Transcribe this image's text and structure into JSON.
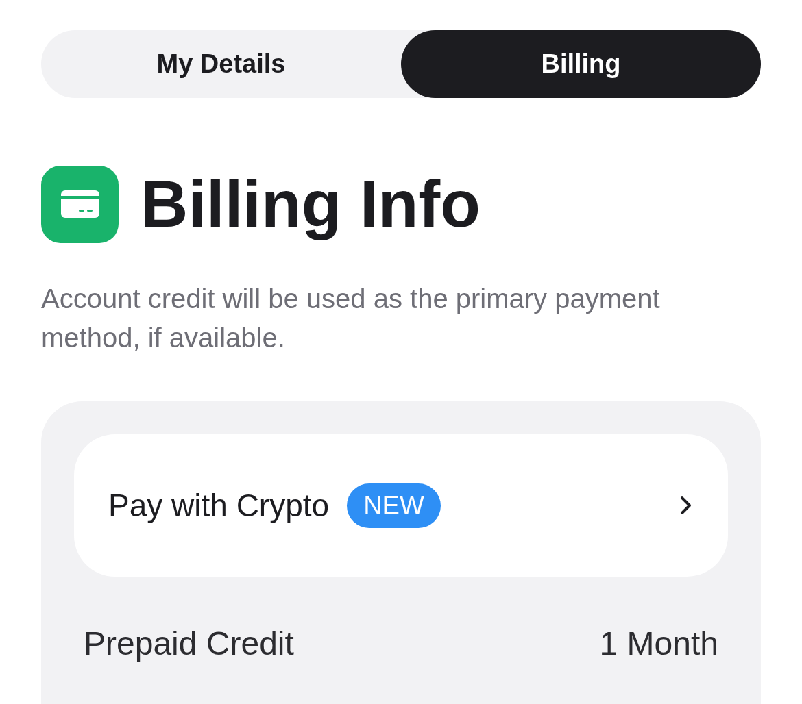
{
  "tabs": [
    {
      "label": "My Details",
      "selected": false
    },
    {
      "label": "Billing",
      "selected": true
    }
  ],
  "header": {
    "title": "Billing Info",
    "description": "Account credit will be used as the primary payment method, if available."
  },
  "card": {
    "action": {
      "label": "Pay with Crypto",
      "badge": "NEW"
    },
    "rows": [
      {
        "label": "Prepaid Credit",
        "value": "1 Month"
      }
    ]
  }
}
